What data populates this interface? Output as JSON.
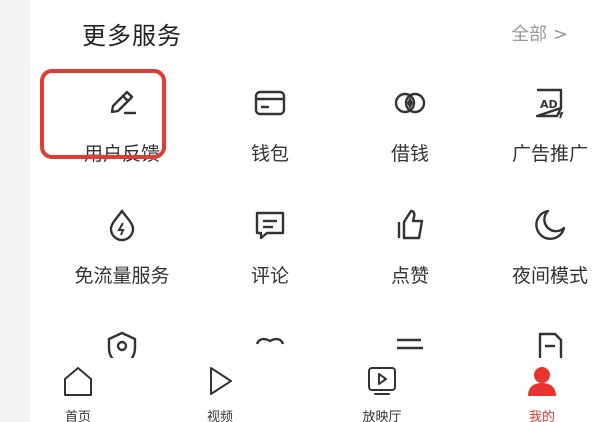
{
  "section": {
    "title": "更多服务",
    "see_all": "全部 >"
  },
  "services": [
    {
      "label": "用户反馈",
      "icon": "pen-feedback-icon"
    },
    {
      "label": "钱包",
      "icon": "wallet-icon"
    },
    {
      "label": "借钱",
      "icon": "loan-icon"
    },
    {
      "label": "广告推广",
      "icon": "ad-icon"
    },
    {
      "label": "免流量服务",
      "icon": "data-drop-icon"
    },
    {
      "label": "评论",
      "icon": "comment-icon"
    },
    {
      "label": "点赞",
      "icon": "thumbs-up-icon"
    },
    {
      "label": "夜间模式",
      "icon": "moon-icon"
    }
  ],
  "tabbar": [
    {
      "label": "首页",
      "icon": "home-icon"
    },
    {
      "label": "视频",
      "icon": "play-icon"
    },
    {
      "label": "放映厅",
      "icon": "theater-icon"
    },
    {
      "label": "我的",
      "icon": "profile-icon",
      "active": true
    }
  ],
  "colors": {
    "accent": "#e8332f",
    "highlight": "#e03c2f",
    "text": "#333333",
    "muted": "#9a9a9a"
  }
}
